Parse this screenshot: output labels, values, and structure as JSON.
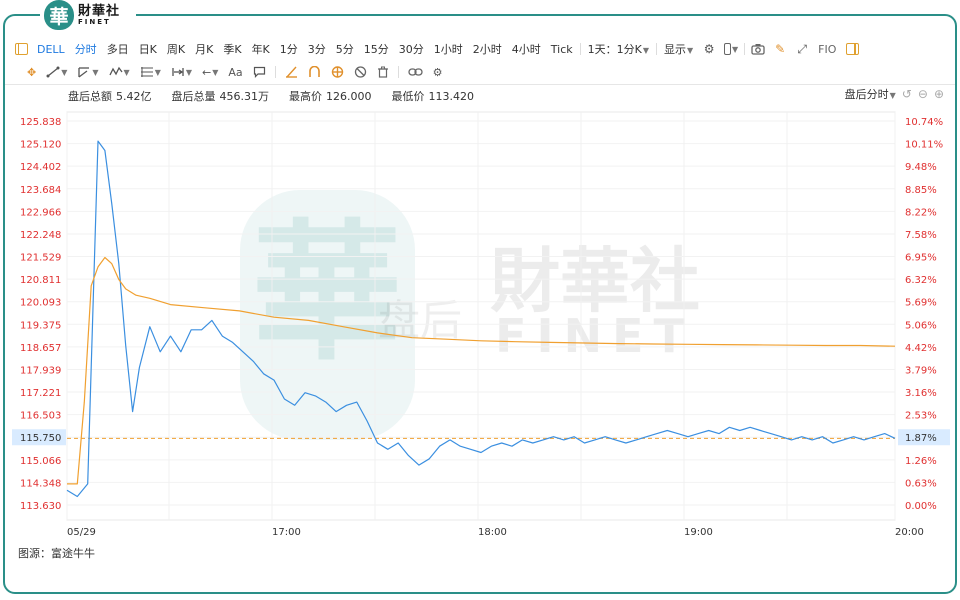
{
  "brand": {
    "seal": "華",
    "cn": "財華社",
    "en": "FINET"
  },
  "toolbar": {
    "symbol": "DELL",
    "periods": [
      "分时",
      "多日",
      "日K",
      "周K",
      "月K",
      "季K",
      "年K",
      "1分",
      "3分",
      "5分",
      "15分",
      "30分",
      "1小时",
      "2小时",
      "4小时",
      "Tick"
    ],
    "active_period": "分时",
    "interval_select": "1天：1分K",
    "display_label": "显示",
    "fio_label": "FIO",
    "text_tool_label": "Aa"
  },
  "stats": {
    "amount_label": "盘后总额",
    "amount_value": "5.42亿",
    "volume_label": "盘后总量",
    "volume_value": "456.31万",
    "high_label": "最高价",
    "high_value": "126.000",
    "low_label": "最低价",
    "low_value": "113.420"
  },
  "chart_controls": {
    "mode_label": "盘后分时"
  },
  "watermark": {
    "seal": "華",
    "cn": "財華社",
    "en": "FINET",
    "side": "盘后"
  },
  "source_text": "图源：富途牛牛",
  "colors": {
    "price_line": "#3b8fe0",
    "avg_line": "#f0a030",
    "accent": "#2a8f88",
    "axis_label": "#e03030",
    "current_line": "#f0a030"
  },
  "chart_data": {
    "type": "line",
    "title": "",
    "xlabel": "",
    "ylabel": "",
    "x_ticks": [
      "05/29",
      "17:00",
      "18:00",
      "19:00",
      "20:00"
    ],
    "ylim": [
      113.63,
      126.0
    ],
    "y_left_ticks": [
      "125.838",
      "125.120",
      "124.402",
      "123.684",
      "122.966",
      "122.248",
      "121.529",
      "120.811",
      "120.093",
      "119.375",
      "118.657",
      "117.939",
      "117.221",
      "116.503",
      "115.750",
      "115.066",
      "114.348",
      "113.630"
    ],
    "y_right_ticks": [
      "10.74%",
      "10.11%",
      "9.48%",
      "8.85%",
      "8.22%",
      "7.58%",
      "6.95%",
      "6.32%",
      "5.69%",
      "5.06%",
      "4.42%",
      "3.79%",
      "3.16%",
      "2.53%",
      "1.87%",
      "1.26%",
      "0.63%",
      "0.00%"
    ],
    "current_price": "115.750",
    "current_pct": "1.87%",
    "grid": true,
    "series": [
      {
        "color": "#3b8fe0",
        "x": [
          0,
          3,
          6,
          9,
          11,
          13,
          15,
          17,
          19,
          21,
          24,
          27,
          30,
          33,
          36,
          39,
          42,
          45,
          48,
          51,
          54,
          57,
          60,
          63,
          66,
          69,
          72,
          75,
          78,
          81,
          84,
          87,
          90,
          93,
          96,
          99,
          102,
          105,
          108,
          111,
          114,
          117,
          120,
          123,
          126,
          129,
          132,
          135,
          138,
          141,
          144,
          147,
          150,
          153,
          156,
          159,
          162,
          165,
          168,
          171,
          174,
          177,
          180,
          183,
          186,
          189,
          192,
          195,
          198,
          201,
          204,
          207,
          210,
          213,
          216,
          219,
          222,
          225,
          228,
          231,
          234,
          237,
          240
        ],
        "y": [
          114.1,
          113.9,
          114.3,
          125.2,
          124.9,
          123.2,
          121.3,
          118.7,
          116.6,
          118.0,
          119.3,
          118.5,
          119.0,
          118.5,
          119.2,
          119.2,
          119.5,
          119.0,
          118.8,
          118.5,
          118.2,
          117.8,
          117.6,
          117.0,
          116.8,
          117.2,
          117.1,
          116.9,
          116.6,
          116.8,
          116.9,
          116.3,
          115.6,
          115.4,
          115.6,
          115.2,
          114.9,
          115.1,
          115.5,
          115.7,
          115.5,
          115.4,
          115.3,
          115.5,
          115.6,
          115.5,
          115.7,
          115.6,
          115.7,
          115.8,
          115.7,
          115.8,
          115.6,
          115.7,
          115.8,
          115.7,
          115.6,
          115.7,
          115.8,
          115.9,
          116.0,
          115.9,
          115.8,
          115.9,
          116.0,
          115.9,
          116.1,
          116.0,
          116.1,
          116.0,
          115.9,
          115.8,
          115.7,
          115.8,
          115.7,
          115.8,
          115.6,
          115.7,
          115.8,
          115.7,
          115.8,
          115.9,
          115.75
        ]
      },
      {
        "color": "#f0a030",
        "x": [
          0,
          3,
          5,
          7,
          9,
          11,
          13,
          15,
          17,
          20,
          24,
          30,
          40,
          50,
          60,
          70,
          80,
          90,
          100,
          110,
          120,
          130,
          140,
          150,
          160,
          170,
          180,
          190,
          200,
          210,
          220,
          230,
          240
        ],
        "y": [
          114.3,
          114.3,
          116.9,
          120.6,
          121.2,
          121.5,
          121.3,
          120.8,
          120.5,
          120.3,
          120.2,
          120.0,
          119.9,
          119.8,
          119.6,
          119.5,
          119.3,
          119.1,
          118.95,
          118.9,
          118.85,
          118.82,
          118.8,
          118.78,
          118.76,
          118.75,
          118.74,
          118.73,
          118.72,
          118.71,
          118.7,
          118.7,
          118.68
        ]
      }
    ]
  }
}
